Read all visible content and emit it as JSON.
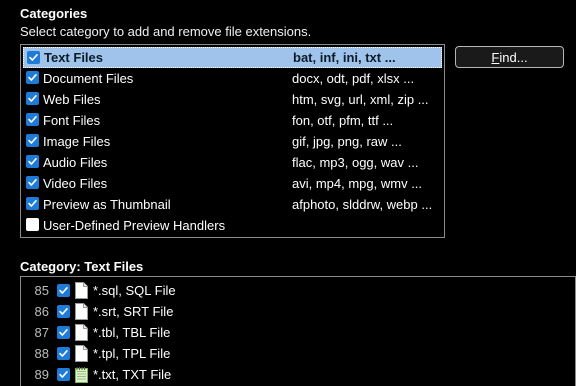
{
  "categories_section": {
    "title": "Categories",
    "hint": "Select category to add and remove file extensions.",
    "find_button": "Find...",
    "items": [
      {
        "name": "Text Files",
        "extensions": "bat, inf, ini, txt ...",
        "checked": true,
        "selected": true
      },
      {
        "name": "Document Files",
        "extensions": "docx, odt, pdf, xlsx ...",
        "checked": true,
        "selected": false
      },
      {
        "name": "Web Files",
        "extensions": "htm, svg, url, xml, zip ...",
        "checked": true,
        "selected": false
      },
      {
        "name": "Font Files",
        "extensions": "fon, otf, pfm, ttf ...",
        "checked": true,
        "selected": false
      },
      {
        "name": "Image Files",
        "extensions": "gif, jpg, png, raw ...",
        "checked": true,
        "selected": false
      },
      {
        "name": "Audio Files",
        "extensions": "flac, mp3, ogg, wav ...",
        "checked": true,
        "selected": false
      },
      {
        "name": "Video Files",
        "extensions": "avi, mp4, mpg, wmv ...",
        "checked": true,
        "selected": false
      },
      {
        "name": "Preview as Thumbnail",
        "extensions": "afphoto, slddrw, webp ...",
        "checked": true,
        "selected": false
      },
      {
        "name": "User-Defined Preview Handlers",
        "extensions": "",
        "checked": false,
        "selected": false
      }
    ]
  },
  "category_detail": {
    "title": "Category: Text Files",
    "files": [
      {
        "num": "85",
        "label": "*.sql, SQL File",
        "checked": true,
        "icon": "document-icon"
      },
      {
        "num": "86",
        "label": "*.srt, SRT File",
        "checked": true,
        "icon": "document-icon"
      },
      {
        "num": "87",
        "label": "*.tbl, TBL File",
        "checked": true,
        "icon": "document-icon"
      },
      {
        "num": "88",
        "label": "*.tpl, TPL File",
        "checked": true,
        "icon": "document-icon"
      },
      {
        "num": "89",
        "label": "*.txt, TXT File",
        "checked": true,
        "icon": "notepad-icon"
      }
    ]
  },
  "colors": {
    "selection": "#9fc3ea",
    "checkbox": "#1f7bd8"
  }
}
